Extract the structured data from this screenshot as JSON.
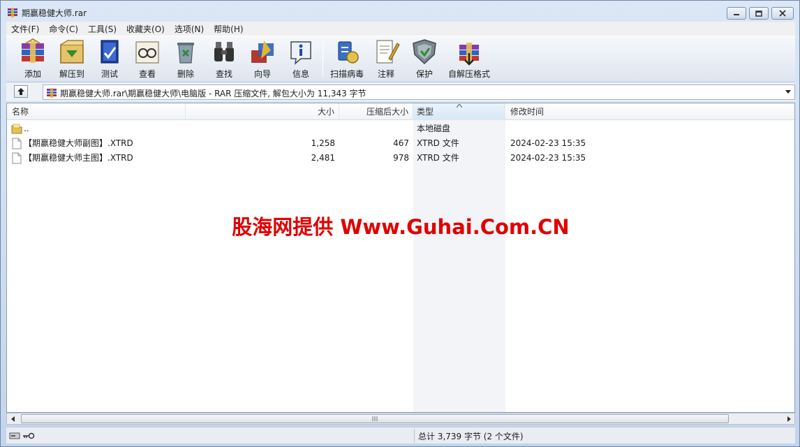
{
  "window": {
    "title": "期赢稳健大师.rar"
  },
  "menu": [
    "文件(F)",
    "命令(C)",
    "工具(S)",
    "收藏夹(O)",
    "选项(N)",
    "帮助(H)"
  ],
  "toolbar": [
    {
      "label": "添加",
      "icon": "add-archive-icon"
    },
    {
      "label": "解压到",
      "icon": "extract-to-icon"
    },
    {
      "label": "测试",
      "icon": "test-icon"
    },
    {
      "label": "查看",
      "icon": "view-icon"
    },
    {
      "label": "删除",
      "icon": "delete-icon"
    },
    {
      "label": "查找",
      "icon": "find-icon"
    },
    {
      "label": "向导",
      "icon": "wizard-icon"
    },
    {
      "label": "信息",
      "icon": "info-icon"
    },
    {
      "label": "扫描病毒",
      "icon": "virus-scan-icon"
    },
    {
      "label": "注释",
      "icon": "comment-icon"
    },
    {
      "label": "保护",
      "icon": "protect-icon"
    },
    {
      "label": "自解压格式",
      "icon": "sfx-icon"
    }
  ],
  "address": {
    "path": "期赢稳健大师.rar\\期赢稳健大师\\电脑版 - RAR 压缩文件, 解包大小为 11,343 字节"
  },
  "columns": {
    "name": "名称",
    "size": "大小",
    "packed": "压缩后大小",
    "type": "类型",
    "modified": "修改时间"
  },
  "files": [
    {
      "name": "..",
      "size": "",
      "packed": "",
      "type": "本地磁盘",
      "modified": "",
      "kind": "folder"
    },
    {
      "name": "【期赢稳健大师副图】.XTRD",
      "size": "1,258",
      "packed": "467",
      "type": "XTRD 文件",
      "modified": "2024-02-23 15:35",
      "kind": "file"
    },
    {
      "name": "【期赢稳健大师主图】.XTRD",
      "size": "2,481",
      "packed": "978",
      "type": "XTRD 文件",
      "modified": "2024-02-23 15:35",
      "kind": "file"
    }
  ],
  "watermark": "股海网提供 Www.Guhai.Com.CN",
  "status": {
    "summary": "总计 3,739 字节 (2 个文件)"
  },
  "colors": {
    "watermark": "#e00000",
    "window_bg": "#c9d9ee"
  }
}
